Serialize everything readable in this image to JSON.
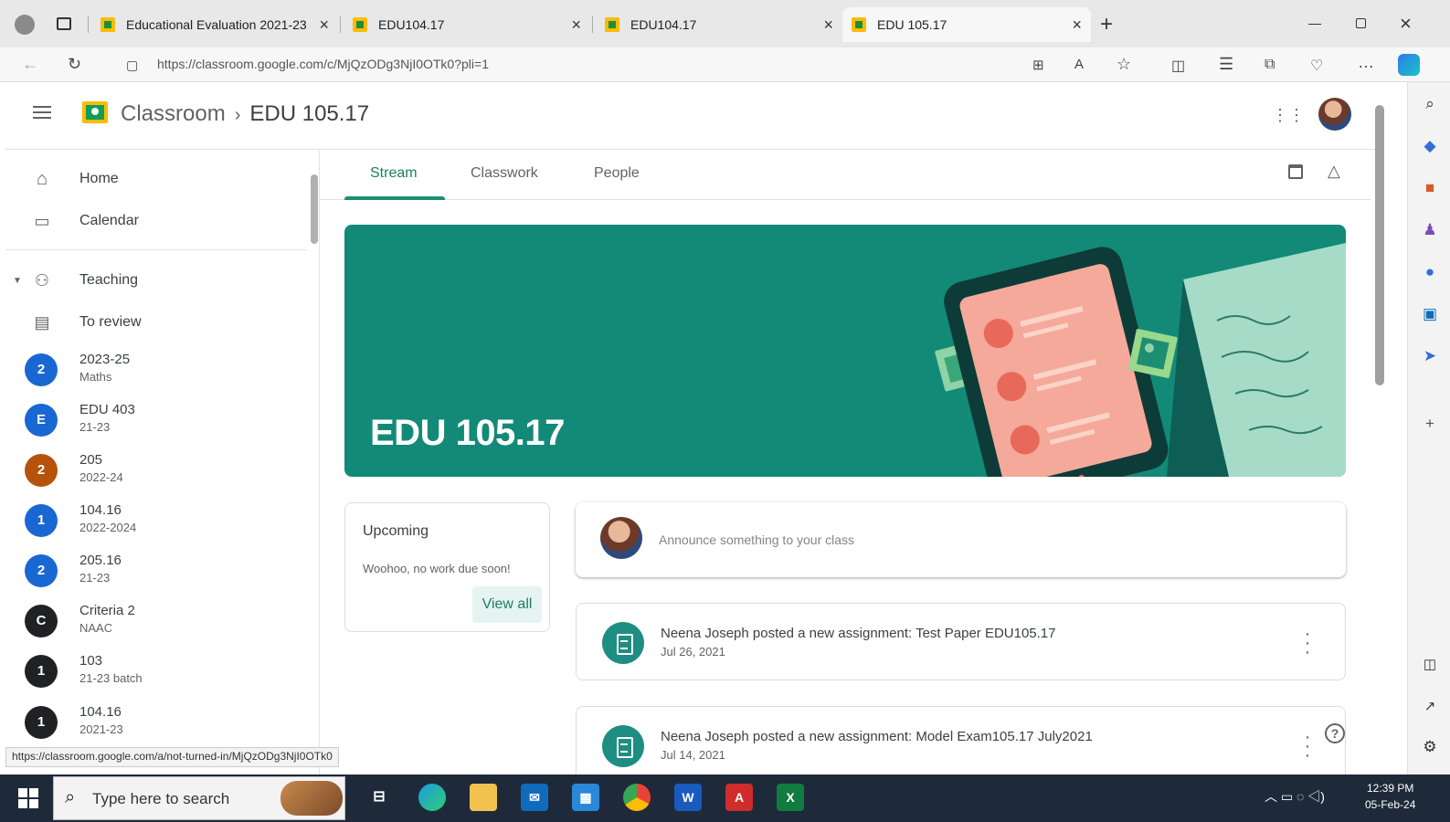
{
  "browser": {
    "tabs": [
      {
        "title": "Educational Evaluation 2021-23",
        "active": false
      },
      {
        "title": "EDU104.17",
        "active": false
      },
      {
        "title": "EDU104.17",
        "active": false
      },
      {
        "title": "EDU 105.17",
        "active": true
      }
    ],
    "url": "https://classroom.google.com/c/MjQzODg3NjI0OTk0?pli=1",
    "status_url": "https://classroom.google.com/a/not-turned-in/MjQzODg3NjI0OTk0"
  },
  "header": {
    "app_name": "Classroom",
    "separator": "›",
    "class_name": "EDU 105.17"
  },
  "sidebar": {
    "home": "Home",
    "calendar": "Calendar",
    "teaching": "Teaching",
    "to_review": "To review",
    "classes": [
      {
        "initial": "2",
        "name": "2023-25",
        "section": "Maths",
        "color": "#1967d2"
      },
      {
        "initial": "E",
        "name": "EDU 403",
        "section": "21-23",
        "color": "#1967d2"
      },
      {
        "initial": "2",
        "name": "205",
        "section": "2022-24",
        "color": "#b45309"
      },
      {
        "initial": "1",
        "name": "104.16",
        "section": "2022-2024",
        "color": "#1967d2"
      },
      {
        "initial": "2",
        "name": "205.16",
        "section": "21-23",
        "color": "#1967d2"
      },
      {
        "initial": "C",
        "name": "Criteria 2",
        "section": "NAAC",
        "color": "#202124"
      },
      {
        "initial": "1",
        "name": "103",
        "section": "21-23 batch",
        "color": "#202124"
      },
      {
        "initial": "1",
        "name": "104.16",
        "section": "2021-23",
        "color": "#202124"
      }
    ]
  },
  "class_tabs": {
    "stream": "Stream",
    "classwork": "Classwork",
    "people": "People"
  },
  "banner": {
    "title": "EDU 105.17",
    "color": "#138a78"
  },
  "upcoming": {
    "title": "Upcoming",
    "message": "Woohoo, no work due soon!",
    "view_all": "View all"
  },
  "announce": {
    "placeholder": "Announce something to your class"
  },
  "posts": [
    {
      "title": "Neena Joseph posted a new assignment: Test Paper EDU105.17",
      "date": "Jul 26, 2021"
    },
    {
      "title": "Neena Joseph posted a new assignment: Model Exam105.17 July2021",
      "date": "Jul 14, 2021"
    }
  ],
  "taskbar": {
    "search_placeholder": "Type here to search",
    "time": "12:39 PM",
    "date": "05-Feb-24"
  },
  "icons": {
    "accent": "#1e8e73"
  }
}
